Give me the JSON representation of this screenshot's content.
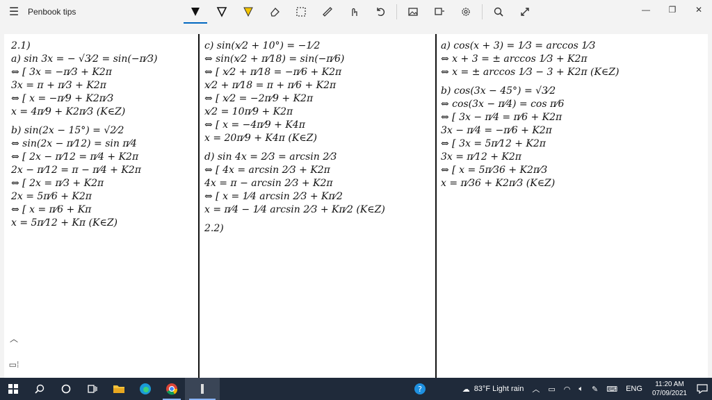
{
  "app": {
    "title": "Penbook tips"
  },
  "toolbar": {
    "tools": [
      {
        "name": "pen-black-icon"
      },
      {
        "name": "pen-black-2-icon"
      },
      {
        "name": "highlighter-icon"
      },
      {
        "name": "eraser-icon"
      },
      {
        "name": "lasso-select-icon"
      },
      {
        "name": "ruler-icon"
      },
      {
        "name": "touch-writing-icon"
      },
      {
        "name": "undo-icon"
      },
      {
        "name": "image-icon"
      },
      {
        "name": "shapes-icon"
      },
      {
        "name": "settings-icon"
      },
      {
        "name": "zoom-icon"
      },
      {
        "name": "fullscreen-icon"
      }
    ]
  },
  "canvas": {
    "col1": [
      "2.1)",
      "a) sin 3x = − √3⁄2 = sin(−π⁄3)",
      "⇔ [ 3x = −π⁄3 + K2π",
      "      3x = π + π⁄3 + K2π",
      "⇔ [ x = −π⁄9 + K2π⁄3",
      "      x = 4π⁄9 + K2π⁄3   (K∈Z)",
      "",
      "b) sin(2x − 15°) = √2⁄2",
      "⇔ sin(2x − π⁄12) = sin π⁄4",
      "⇔ [ 2x − π⁄12 = π⁄4 + K2π",
      "      2x − π⁄12 = π − π⁄4 + K2π",
      "⇔ [ 2x = π⁄3 + K2π",
      "      2x = 5π⁄6 + K2π",
      "⇔ [ x = π⁄6 + Kπ",
      "      x = 5π⁄12 + Kπ   (K∈Z)"
    ],
    "col2": [
      "c) sin(x⁄2 + 10°) = −1⁄2",
      "⇔ sin(x⁄2 + π⁄18) = sin(−π⁄6)",
      "⇔ [ x⁄2 + π⁄18 = −π⁄6 + K2π",
      "      x⁄2 + π⁄18 = π + π⁄6 + K2π",
      "⇔ [ x⁄2 = −2π⁄9 + K2π",
      "      x⁄2 = 10π⁄9 + K2π",
      "⇔ [ x = −4π⁄9 + K4π",
      "      x = 20π⁄9 + K4π   (K∈Z)",
      "",
      "d) sin 4x = 2⁄3 = arcsin 2⁄3",
      "⇔ [ 4x = arcsin 2⁄3 + K2π",
      "      4x = π − arcsin 2⁄3 + K2π",
      "⇔ [ x = 1⁄4 arcsin 2⁄3 + Kπ⁄2",
      "      x = π⁄4 − 1⁄4 arcsin 2⁄3 + Kπ⁄2   (K∈Z)",
      "",
      "2.2)"
    ],
    "col3": [
      "a) cos(x + 3) = 1⁄3 = arccos 1⁄3",
      "⇔ x + 3 = ± arccos 1⁄3 + K2π",
      "⇔ x = ± arccos 1⁄3 − 3 + K2π  (K∈Z)",
      "",
      "b) cos(3x − 45°) = √3⁄2",
      "⇔ cos(3x − π⁄4) = cos π⁄6",
      "⇔ [ 3x − π⁄4 = π⁄6 + K2π",
      "      3x − π⁄4 = −π⁄6 + K2π",
      "⇔ [ 3x = 5π⁄12 + K2π",
      "      3x = π⁄12 + K2π",
      "⇔ [ x = 5π⁄36 + K2π⁄3",
      "      x = π⁄36 + K2π⁄3   (K∈Z)"
    ]
  },
  "taskbar": {
    "weather": "83°F  Light rain",
    "lang": "ENG",
    "time": "11:20 AM",
    "date": "07/09/2021"
  }
}
